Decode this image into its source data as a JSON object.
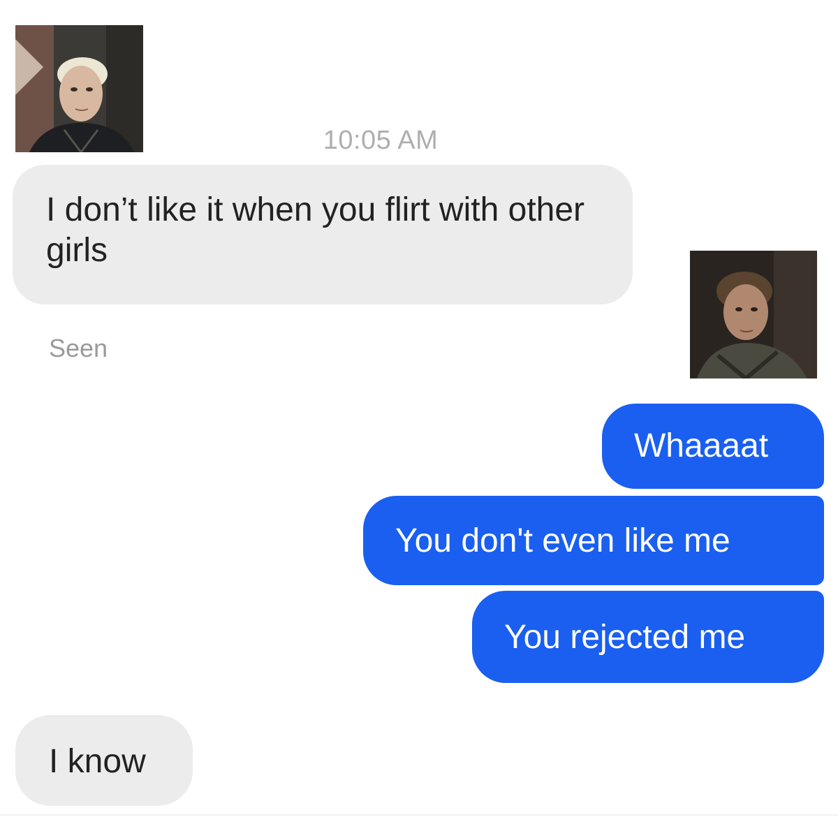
{
  "conversation": {
    "timestamp": "10:05 AM",
    "seen_label": "Seen",
    "messages": [
      {
        "sender": "incoming",
        "text": "I don’t like it when you flirt with other girls"
      },
      {
        "sender": "outgoing",
        "text": "Whaaaat"
      },
      {
        "sender": "outgoing",
        "text": "You don't even like me"
      },
      {
        "sender": "outgoing",
        "text": "You rejected me"
      },
      {
        "sender": "incoming",
        "text": "I know"
      }
    ]
  },
  "avatars": {
    "left": "avatar-photo-icon",
    "right": "avatar-photo-icon"
  },
  "colors": {
    "incoming_bubble": "#ececec",
    "outgoing_bubble": "#1a5ff0",
    "timestamp_text": "#aeaeae",
    "seen_text": "#9a9a9a"
  }
}
